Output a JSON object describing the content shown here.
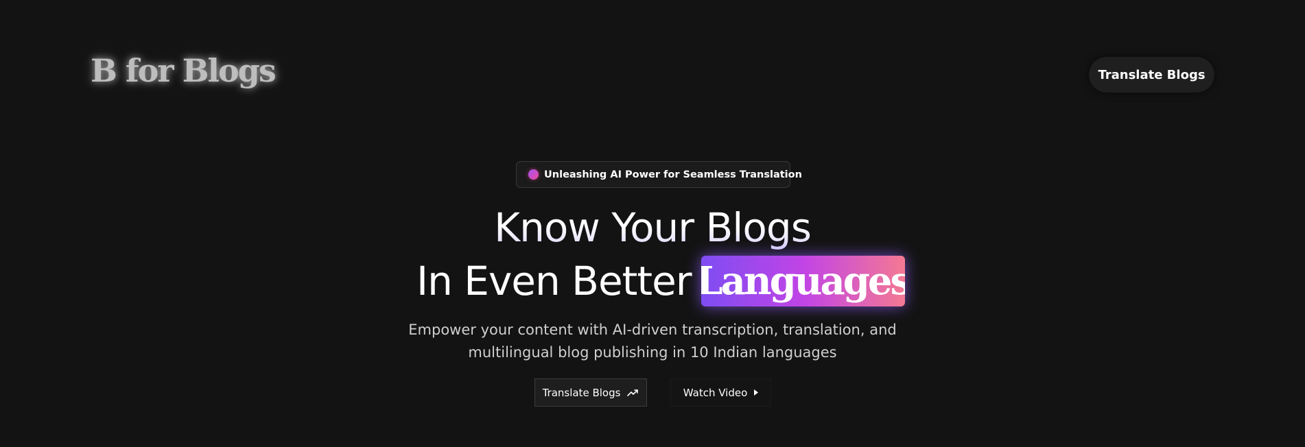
{
  "header": {
    "logo": "B for Blogs",
    "cta_label": "Translate Blogs"
  },
  "hero": {
    "badge_text": "Unleashing AI Power for Seamless Translation",
    "headline_line1": "Know Your Blogs",
    "headline_line2": "In Even Better",
    "headline_highlight": "Languages",
    "subtitle_line1": "Empower your content with AI-driven transcription, translation, and",
    "subtitle_line2": "multilingual blog publishing in 10 Indian languages",
    "primary_button_label": "Translate Blogs",
    "primary_button_icon": "trending-up-icon",
    "secondary_button_label": "Watch Video",
    "secondary_button_icon": "play-triangle-icon"
  },
  "colors": {
    "background": "#131313",
    "highlight_gradient_start": "#7e4df2",
    "highlight_gradient_mid": "#c144e6",
    "highlight_gradient_end": "#f47993",
    "badge_dot_start": "#a855f7",
    "badge_dot_end": "#ec4899"
  }
}
